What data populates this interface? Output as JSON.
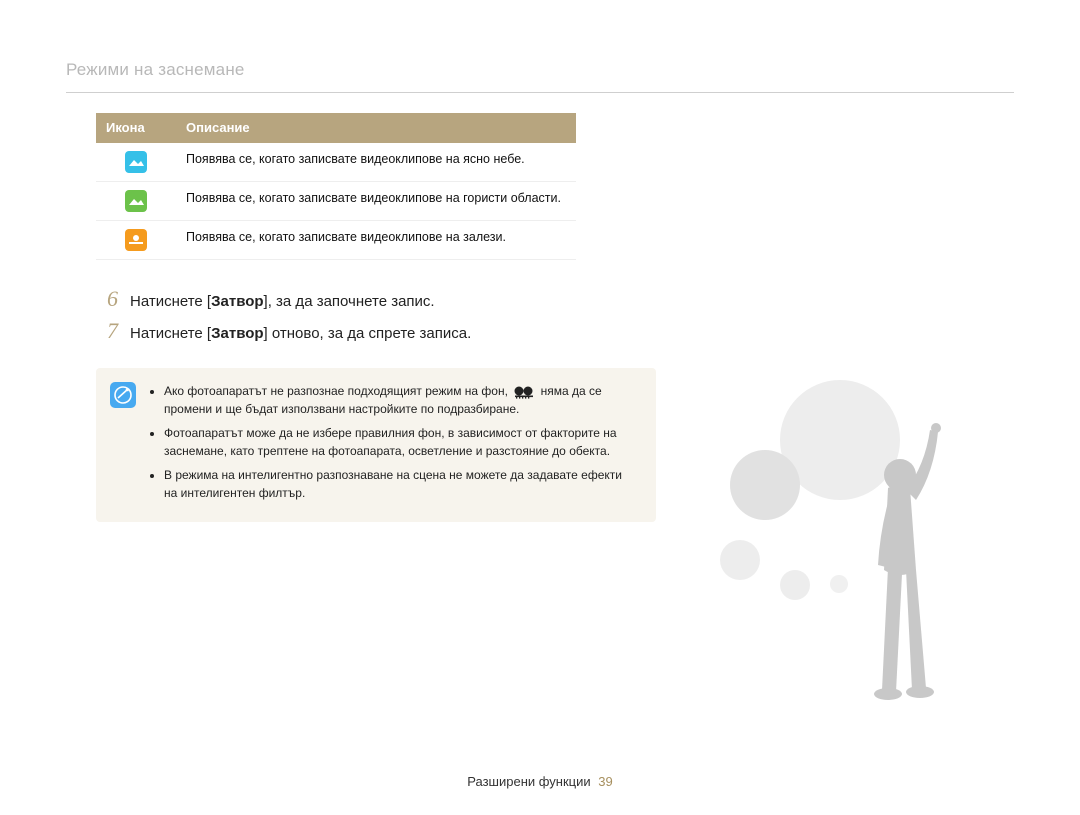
{
  "section_title": "Режими на заснемане",
  "table": {
    "headers": {
      "icon": "Икона",
      "desc": "Описание"
    },
    "rows": [
      {
        "icon_kind": "sky",
        "desc": "Появява се, когато записвате видеоклипове на ясно небе."
      },
      {
        "icon_kind": "forest",
        "desc": "Появява се, когато записвате видеоклипове на гористи области."
      },
      {
        "icon_kind": "sunset",
        "desc": "Появява се, когато записвате видеоклипове на залези."
      }
    ]
  },
  "steps": [
    {
      "n": "6",
      "prefix": "Натиснете [",
      "bold": "Затвор",
      "suffix": "], за да започнете запис."
    },
    {
      "n": "7",
      "prefix": "Натиснете [",
      "bold": "Затвор",
      "suffix": "] отново, за да спрете записа."
    }
  ],
  "note": {
    "bullets": [
      {
        "pre": "Ако фотоапаратът не разпознае подходящият режим на фон, ",
        "has_icon": true,
        "post": " няма да се промени и ще бъдат използвани настройките по подразбиране."
      },
      {
        "pre": "Фотоапаратът може да не избере правилния фон, в зависимост от факторите на заснемане, като трептене на фотоапарата, осветление и разстояние до обекта.",
        "has_icon": false,
        "post": ""
      },
      {
        "pre": "В режима на интелигентно разпознаване на сцена не можете да задавате ефекти на интелигентен филтър.",
        "has_icon": false,
        "post": ""
      }
    ]
  },
  "footer": {
    "label": "Разширени функции",
    "page": "39"
  }
}
